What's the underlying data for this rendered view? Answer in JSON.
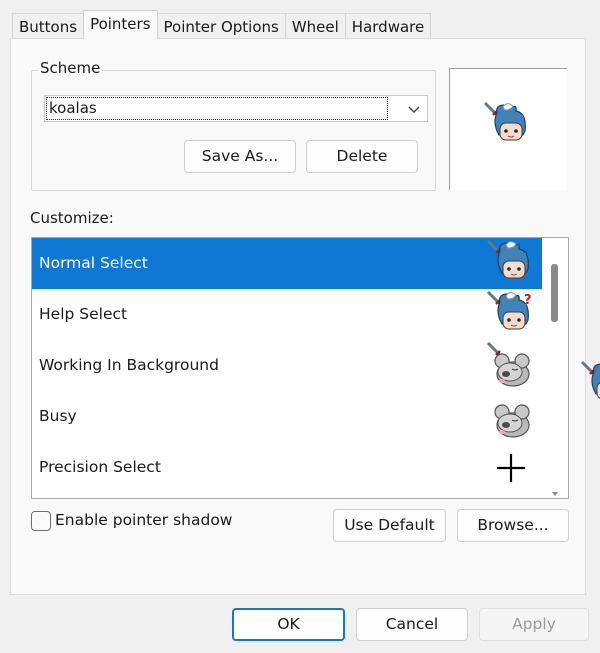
{
  "tabs": [
    "Buttons",
    "Pointers",
    "Pointer Options",
    "Wheel",
    "Hardware"
  ],
  "active_tab": "Pointers",
  "scheme": {
    "group_label": "Scheme",
    "value": "koalas",
    "save_as_label": "Save As...",
    "delete_label": "Delete"
  },
  "customize_label": "Customize:",
  "cursors": [
    {
      "label": "Normal Select",
      "icon": "boy-cursor-icon",
      "selected": true
    },
    {
      "label": "Help Select",
      "icon": "boy-help-cursor-icon",
      "selected": false
    },
    {
      "label": "Working In Background",
      "icon": "koala-working-cursor-icon",
      "selected": false
    },
    {
      "label": "Busy",
      "icon": "koala-busy-cursor-icon",
      "selected": false
    },
    {
      "label": "Precision Select",
      "icon": "crosshair-icon",
      "selected": false
    }
  ],
  "shadow_label": "Enable pointer shadow",
  "shadow_checked": false,
  "use_default_label": "Use Default",
  "browse_label": "Browse...",
  "footer": {
    "ok_label": "OK",
    "cancel_label": "Cancel",
    "apply_label": "Apply",
    "apply_enabled": false
  },
  "colors": {
    "selection": "#0f78d4",
    "ok_border": "#0f78d4",
    "boy_hair": "#3f83b8",
    "koala_fur": "#a9a9a9"
  }
}
